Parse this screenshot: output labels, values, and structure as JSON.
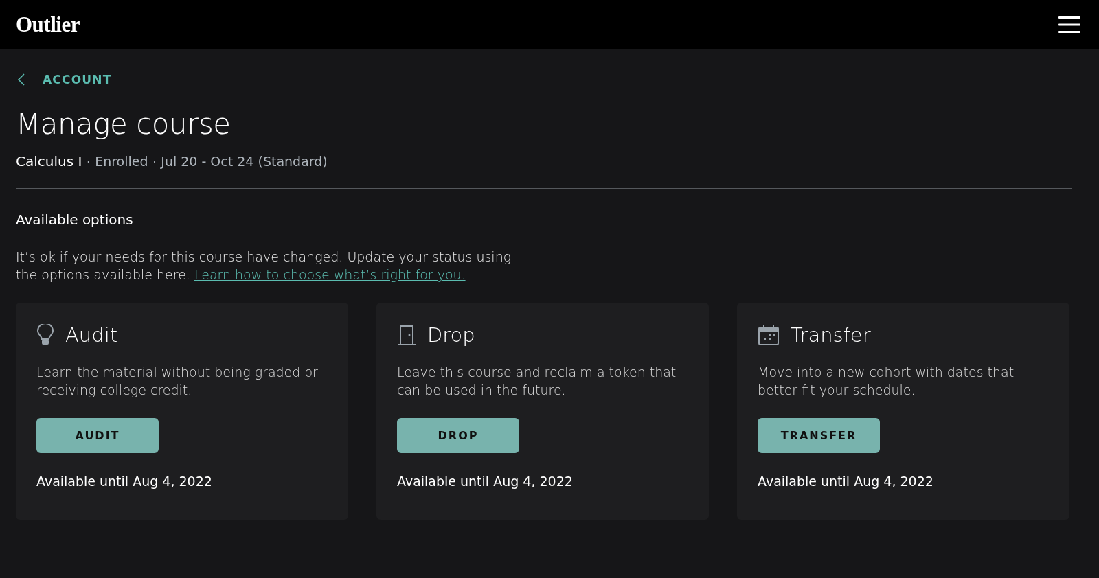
{
  "header": {
    "logo": "Outlier"
  },
  "back_link": {
    "label": "ACCOUNT"
  },
  "page_title": "Manage course",
  "course": {
    "name": "Calculus I",
    "separator": "·",
    "status": "Enrolled",
    "dates": "Jul 20 - Oct 24 (Standard)"
  },
  "section_title": "Available options",
  "intro": {
    "text": "It’s ok if your needs for this course have changed. Update your status using the options available here. ",
    "link": "Learn how to choose what’s right for you."
  },
  "options": [
    {
      "kind": "audit",
      "title": "Audit",
      "description": "Learn the material without being graded or receiving college credit.",
      "button": "AUDIT",
      "availability": "Available until Aug 4, 2022"
    },
    {
      "kind": "drop",
      "title": "Drop",
      "description": "Leave this course and reclaim a token that can be used in the future.",
      "button": "DROP",
      "availability": "Available until Aug 4, 2022"
    },
    {
      "kind": "transfer",
      "title": "Transfer",
      "description": "Move into a new cohort with dates that better fit your schedule.",
      "button": "TRANSFER",
      "availability": "Available until Aug 4, 2022"
    }
  ]
}
